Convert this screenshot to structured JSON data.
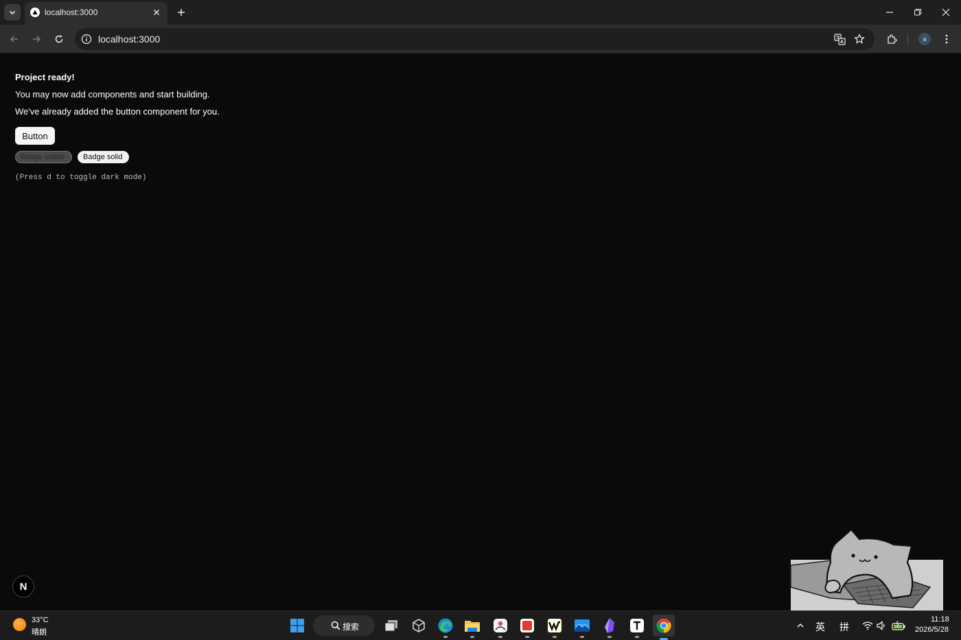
{
  "browser": {
    "tab_title": "localhost:3000",
    "url": "localhost:3000",
    "profile_initial": "a"
  },
  "page": {
    "heading": "Project ready!",
    "line1": "You may now add components and start building.",
    "line2": "We've already added the button component for you.",
    "button_label": "Button",
    "badge_subtle": "Badge subtle",
    "badge_solid": "Badge solid",
    "hint": "(Press d to toggle dark mode)",
    "next_indicator": "N"
  },
  "taskbar": {
    "weather_temp": "33°C",
    "weather_condition": "晴朗",
    "search_label": "搜索",
    "ime_language": "英",
    "ime_mode": "拼",
    "time": "11:18",
    "date": "2026/5/28",
    "apps": [
      "start-menu",
      "search",
      "task-view",
      "unity",
      "edge",
      "file-explorer",
      "pinned-app",
      "red-app",
      "wps",
      "photos",
      "obsidian",
      "typora",
      "chrome"
    ]
  },
  "colors": {
    "page_background": "#0a0a0a",
    "browser_chrome": "#2e2e2e",
    "tab_strip": "#1f1f1f",
    "taskbar": "#1c1c1c"
  }
}
